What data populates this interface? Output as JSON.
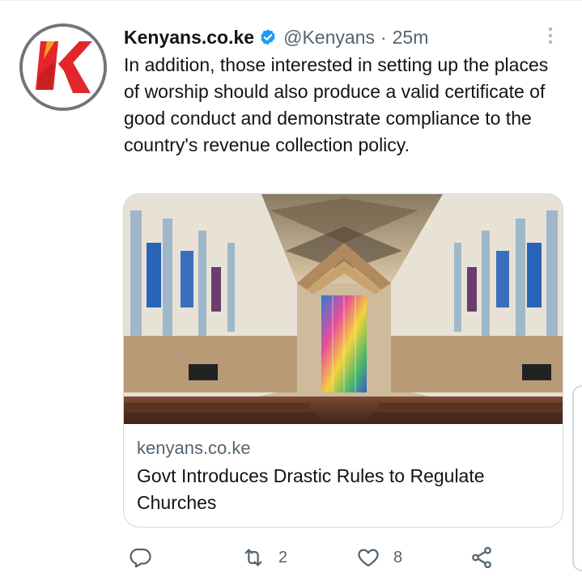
{
  "tweet": {
    "author_name": "Kenyans.co.ke",
    "handle": "@Kenyans",
    "separator": "·",
    "time": "25m",
    "text": "In addition, those interested in setting up the places of worship should also produce a valid certificate of good conduct and demonstrate compliance to the country's revenue collection policy."
  },
  "card": {
    "domain": "kenyans.co.ke",
    "title": "Govt Introduces Drastic Rules to Regulate Churches"
  },
  "actions": {
    "reply_count": "",
    "retweet_count": "2",
    "like_count": "8"
  },
  "icons": {
    "verified": "verified-badge-icon",
    "more": "more-vertical-icon",
    "reply": "reply-icon",
    "retweet": "retweet-icon",
    "like": "heart-icon",
    "share": "share-icon"
  },
  "colors": {
    "verified_blue": "#1d9bf0",
    "logo_red": "#e3262b",
    "muted_text": "#536471",
    "border": "#cfd9de"
  }
}
